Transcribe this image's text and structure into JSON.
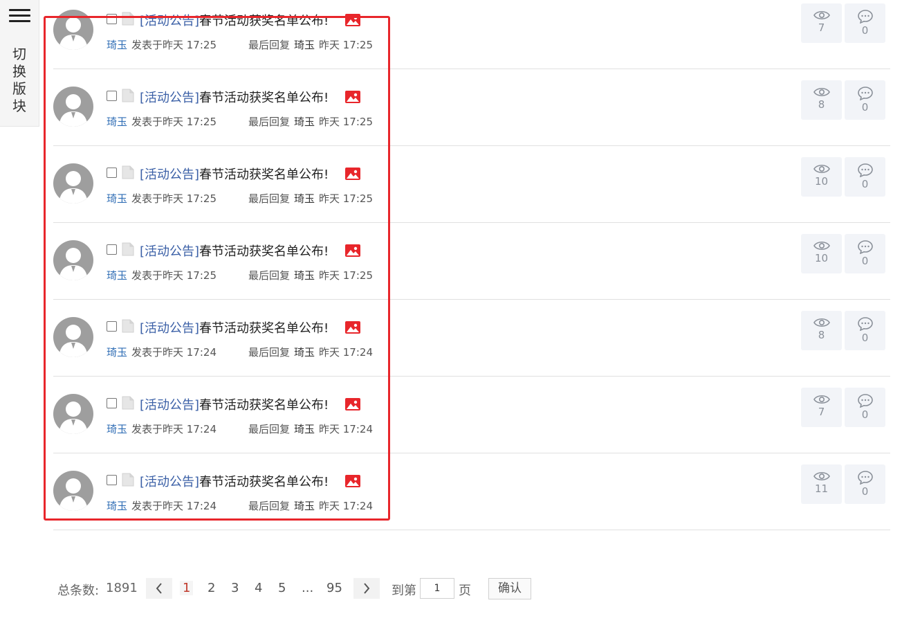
{
  "sidebar": {
    "switch_label_chars": [
      "切",
      "换",
      "版",
      "块"
    ]
  },
  "threads": [
    {
      "tag": "[活动公告]",
      "title": "春节活动获奖名单公布!",
      "author": "琦玉",
      "post_time": "发表于昨天 17:25",
      "last_reply_label": "最后回复",
      "last_reply_user": "琦玉",
      "last_reply_time": "昨天 17:25",
      "views": "7",
      "comments": "0"
    },
    {
      "tag": "[活动公告]",
      "title": "春节活动获奖名单公布!",
      "author": "琦玉",
      "post_time": "发表于昨天 17:25",
      "last_reply_label": "最后回复",
      "last_reply_user": "琦玉",
      "last_reply_time": "昨天 17:25",
      "views": "8",
      "comments": "0"
    },
    {
      "tag": "[活动公告]",
      "title": "春节活动获奖名单公布!",
      "author": "琦玉",
      "post_time": "发表于昨天 17:25",
      "last_reply_label": "最后回复",
      "last_reply_user": "琦玉",
      "last_reply_time": "昨天 17:25",
      "views": "10",
      "comments": "0"
    },
    {
      "tag": "[活动公告]",
      "title": "春节活动获奖名单公布!",
      "author": "琦玉",
      "post_time": "发表于昨天 17:25",
      "last_reply_label": "最后回复",
      "last_reply_user": "琦玉",
      "last_reply_time": "昨天 17:25",
      "views": "10",
      "comments": "0"
    },
    {
      "tag": "[活动公告]",
      "title": "春节活动获奖名单公布!",
      "author": "琦玉",
      "post_time": "发表于昨天 17:24",
      "last_reply_label": "最后回复",
      "last_reply_user": "琦玉",
      "last_reply_time": "昨天 17:24",
      "views": "8",
      "comments": "0"
    },
    {
      "tag": "[活动公告]",
      "title": "春节活动获奖名单公布!",
      "author": "琦玉",
      "post_time": "发表于昨天 17:24",
      "last_reply_label": "最后回复",
      "last_reply_user": "琦玉",
      "last_reply_time": "昨天 17:24",
      "views": "7",
      "comments": "0"
    },
    {
      "tag": "[活动公告]",
      "title": "春节活动获奖名单公布!",
      "author": "琦玉",
      "post_time": "发表于昨天 17:24",
      "last_reply_label": "最后回复",
      "last_reply_user": "琦玉",
      "last_reply_time": "昨天 17:24",
      "views": "11",
      "comments": "0"
    }
  ],
  "pagination": {
    "total_label": "总条数:",
    "total_value": "1891",
    "pages": [
      "1",
      "2",
      "3",
      "4",
      "5",
      "...",
      "95"
    ],
    "current_page": "1",
    "goto_label": "到第",
    "goto_value": "1",
    "page_unit": "页",
    "confirm_label": "确认"
  },
  "icons": {
    "menu": "hamburger-icon",
    "avatar": "user-avatar-icon",
    "doc": "document-icon",
    "image": "image-attachment-icon",
    "views": "eye-icon",
    "comments": "comment-icon",
    "prev": "chevron-left-icon",
    "next": "chevron-right-icon"
  },
  "colors": {
    "highlight": "#e8262b",
    "link": "#2f6db5",
    "tag": "#3a5fa6",
    "image_icon": "#e8262b",
    "stat_bg": "#f2f4f8"
  }
}
